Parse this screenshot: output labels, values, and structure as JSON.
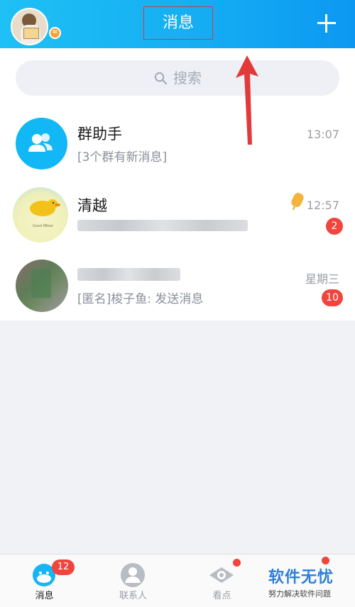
{
  "header": {
    "title": "消息",
    "status_glyph": "="
  },
  "search": {
    "placeholder": "搜索"
  },
  "conversations": [
    {
      "name": "群助手",
      "preview": "[3个群有新消息]",
      "time": "13:07",
      "avatar_icon": "group-icon",
      "avatar_color": "#12b7f5"
    },
    {
      "name": "清越",
      "preview": "",
      "time": "12:57",
      "unread": "2",
      "avatar_text": "Good Mtbai"
    },
    {
      "name": "",
      "preview": "[匿名]梭子鱼: 发送消息",
      "time": "星期三",
      "unread": "10"
    }
  ],
  "tabbar": {
    "tabs": [
      {
        "label": "消息",
        "badge": "12",
        "active": true,
        "icon": "chat-icon"
      },
      {
        "label": "联系人",
        "icon": "contact-icon"
      },
      {
        "label": "看点",
        "icon": "eye-icon",
        "dot": true
      },
      {
        "label": "",
        "icon": "",
        "dot": true
      }
    ]
  },
  "watermark": {
    "main": "软件无忧",
    "sub": "努力解决软件问题"
  },
  "colors": {
    "header_start": "#1ec0f5",
    "header_end": "#0c98f2",
    "badge": "#f0443d",
    "annotation": "#e23a3a"
  }
}
